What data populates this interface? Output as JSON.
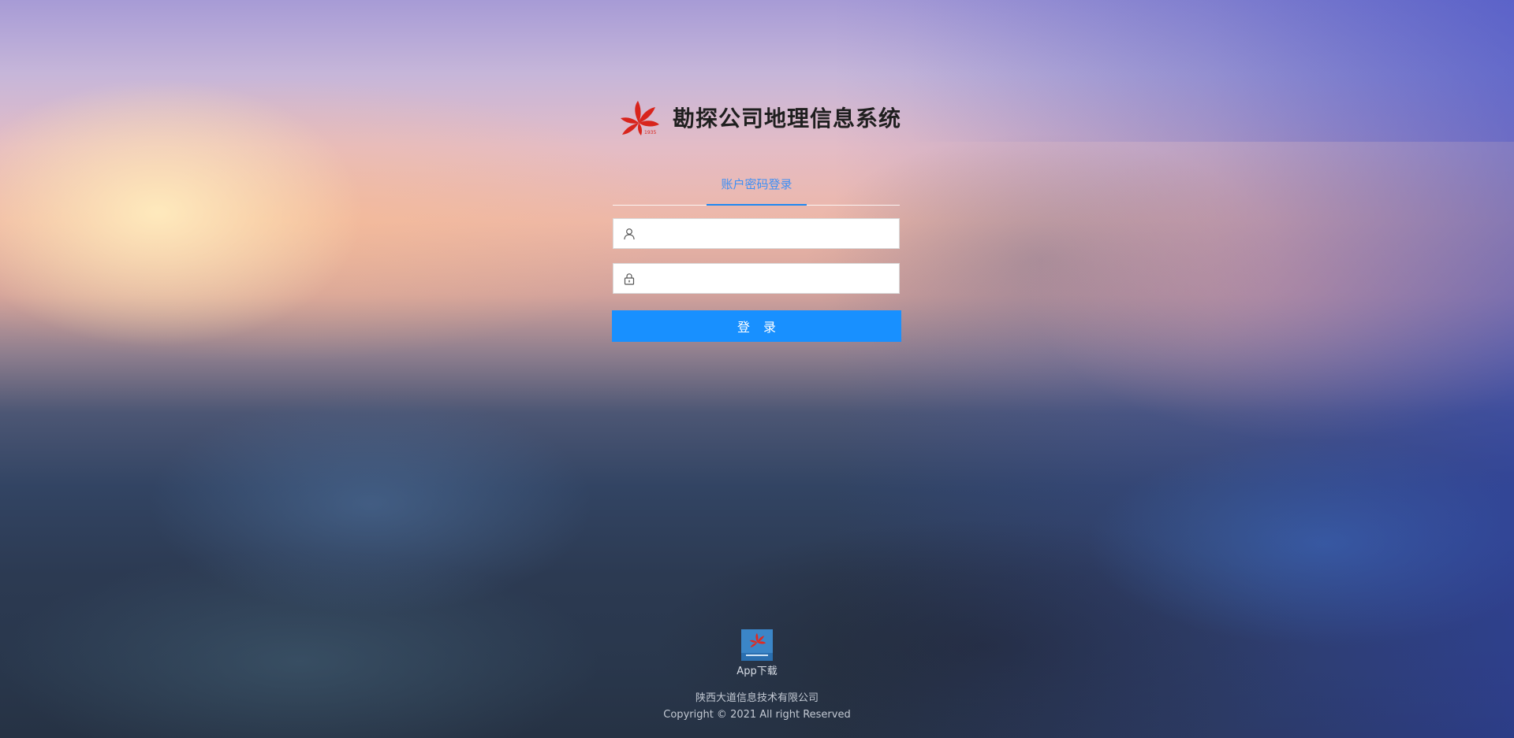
{
  "header": {
    "logo_icon": "company-flower-logo-icon",
    "title": "勘探公司地理信息系统"
  },
  "login": {
    "tab_label": "账户密码登录",
    "username": {
      "icon": "user-icon",
      "value": "",
      "placeholder": ""
    },
    "password": {
      "icon": "lock-icon",
      "value": "",
      "placeholder": ""
    },
    "submit_label": "登 录"
  },
  "app_download": {
    "icon": "app-icon",
    "label": "App下载"
  },
  "footer": {
    "company": "陕西大道信息技术有限公司",
    "copyright": "Copyright © 2021 All right Reserved"
  },
  "colors": {
    "accent": "#1890ff",
    "tab_active": "#3d8ff5",
    "logo_red": "#d8241c",
    "title": "#1f1f1f"
  }
}
